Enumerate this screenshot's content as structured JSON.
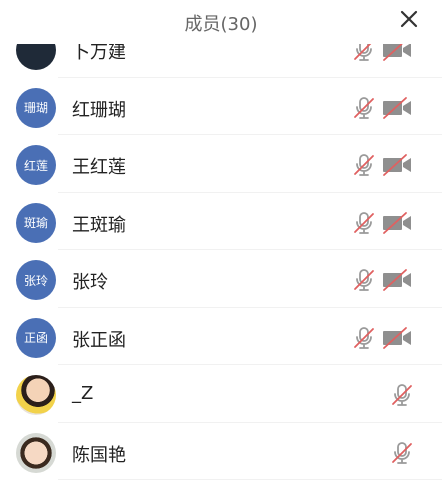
{
  "header": {
    "title": "成员(30)"
  },
  "members": [
    {
      "name": "卜万建",
      "avatar_text": "",
      "avatar_style": "dark",
      "has_camera": true
    },
    {
      "name": "红珊瑚",
      "avatar_text": "珊瑚",
      "avatar_style": "blue",
      "has_camera": true
    },
    {
      "name": "王红莲",
      "avatar_text": "红莲",
      "avatar_style": "blue",
      "has_camera": true
    },
    {
      "name": "王斑瑜",
      "avatar_text": "斑瑜",
      "avatar_style": "blue",
      "has_camera": true
    },
    {
      "name": "张玲",
      "avatar_text": "张玲",
      "avatar_style": "blue",
      "has_camera": true
    },
    {
      "name": "张正函",
      "avatar_text": "正函",
      "avatar_style": "blue",
      "has_camera": true
    },
    {
      "name": "_Z",
      "avatar_text": "",
      "avatar_style": "photo1",
      "has_camera": false
    },
    {
      "name": "陈国艳",
      "avatar_text": "",
      "avatar_style": "photo2",
      "has_camera": false
    }
  ],
  "icons": {
    "close": "close-icon",
    "mic": "mic-muted-icon",
    "camera": "camera-off-icon"
  },
  "colors": {
    "accent_blue": "#4a6fb5",
    "muted_red": "#e06060",
    "icon_gray": "#9a9a9a"
  }
}
